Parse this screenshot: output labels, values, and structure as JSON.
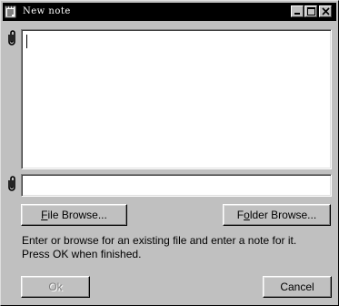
{
  "window": {
    "title": "New note",
    "icon": "notepad-icon",
    "controls": [
      "minimize-icon",
      "maximize-icon",
      "close-icon"
    ]
  },
  "note": {
    "value": "",
    "icon": "paperclip-icon"
  },
  "file": {
    "value": "",
    "icon": "paperclip-icon"
  },
  "buttons": {
    "file_browse": {
      "accel": "F",
      "rest": "ile Browse..."
    },
    "folder_browse": {
      "pre": "F",
      "accel": "o",
      "rest": "lder Browse..."
    },
    "ok": "Ok",
    "cancel": "Cancel"
  },
  "instructions": {
    "line1": "Enter or browse for an existing file and enter a note for it.",
    "line2": "Press OK when finished."
  },
  "colors": {
    "face": "#c0c0c0",
    "titlebar": "#000000",
    "field": "#ffffff",
    "disabled_text": "#808080"
  }
}
